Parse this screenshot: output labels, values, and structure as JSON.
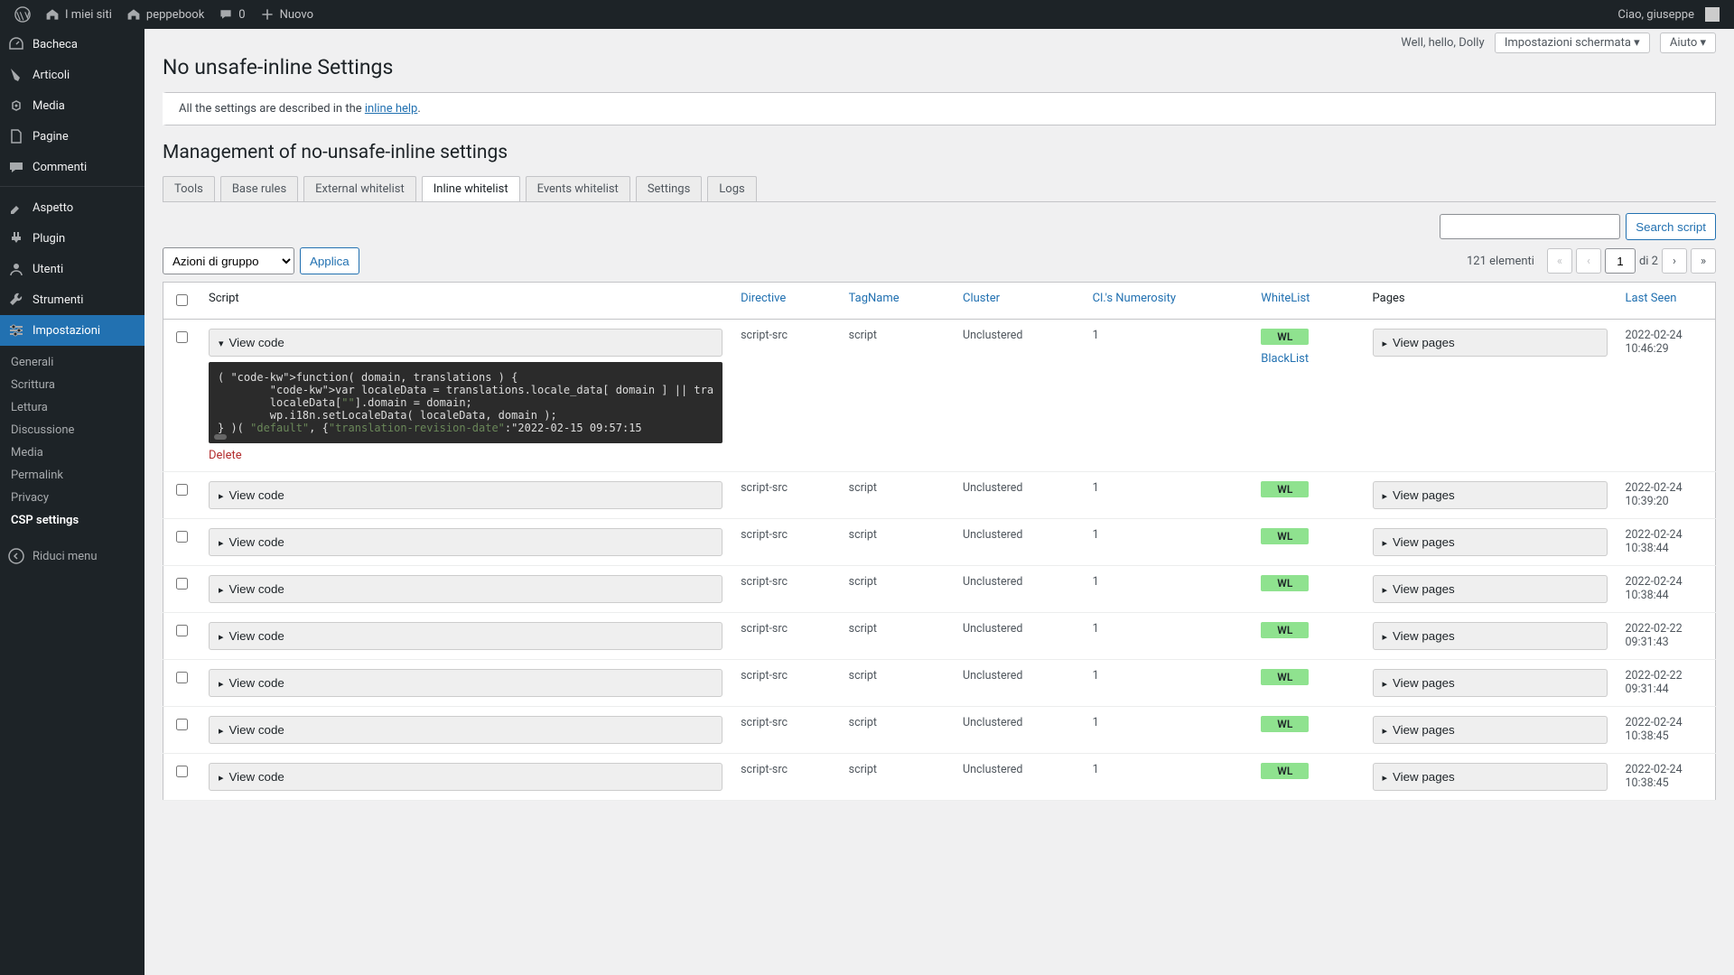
{
  "adminbar": {
    "mysites": "I miei siti",
    "sitename": "peppebook",
    "comments": "0",
    "new": "Nuovo",
    "howdy": "Ciao, giuseppe"
  },
  "sidebar": {
    "items": [
      {
        "icon": "dashboard",
        "label": "Bacheca"
      },
      {
        "icon": "post",
        "label": "Articoli"
      },
      {
        "icon": "media",
        "label": "Media"
      },
      {
        "icon": "page",
        "label": "Pagine"
      },
      {
        "icon": "comments",
        "label": "Commenti"
      },
      {
        "icon": "appearance",
        "label": "Aspetto"
      },
      {
        "icon": "plugin",
        "label": "Plugin"
      },
      {
        "icon": "users",
        "label": "Utenti"
      },
      {
        "icon": "tools",
        "label": "Strumenti"
      },
      {
        "icon": "settings",
        "label": "Impostazioni"
      }
    ],
    "submenu": [
      "Generali",
      "Scrittura",
      "Lettura",
      "Discussione",
      "Media",
      "Permalink",
      "Privacy",
      "CSP settings"
    ],
    "collapse": "Riduci menu"
  },
  "header": {
    "dolly": "Well, hello, Dolly",
    "screenoptions": "Impostazioni schermata",
    "help": "Aiuto",
    "title": "No unsafe-inline Settings",
    "notice_pre": "All the settings are described in the ",
    "notice_link": "inline help",
    "section": "Management of no-unsafe-inline settings"
  },
  "tabs": [
    "Tools",
    "Base rules",
    "External whitelist",
    "Inline whitelist",
    "Events whitelist",
    "Settings",
    "Logs"
  ],
  "active_tab": 3,
  "bulk": {
    "select": "Azioni di gruppo",
    "apply": "Applica"
  },
  "search": {
    "button": "Search script"
  },
  "pager": {
    "count": "121 elementi",
    "page": "1",
    "of": "di 2"
  },
  "columns": {
    "script": "Script",
    "directive": "Directive",
    "tagname": "TagName",
    "cluster": "Cluster",
    "numerosity": "Cl.'s Numerosity",
    "whitelist": "WhiteList",
    "pages": "Pages",
    "lastseen": "Last Seen"
  },
  "buttons": {
    "viewcode": "View code",
    "viewpages": "View pages",
    "delete": "Delete",
    "blacklist": "BlackList"
  },
  "badge": "WL",
  "code_lines": [
    "( function( domain, translations ) {",
    "        var localeData = translations.locale_data[ domain ] || tra",
    "        localeData[\"\"].domain = domain;",
    "        wp.i18n.setLocaleData( localeData, domain );",
    "} )( \"default\", {\"translation-revision-date\":\"2022-02-15 09:57:15"
  ],
  "rows": [
    {
      "directive": "script-src",
      "tagname": "script",
      "cluster": "Unclustered",
      "num": "1",
      "lastseen": "2022-02-24 10:46:29",
      "expanded": true
    },
    {
      "directive": "script-src",
      "tagname": "script",
      "cluster": "Unclustered",
      "num": "1",
      "lastseen": "2022-02-24 10:39:20"
    },
    {
      "directive": "script-src",
      "tagname": "script",
      "cluster": "Unclustered",
      "num": "1",
      "lastseen": "2022-02-24 10:38:44"
    },
    {
      "directive": "script-src",
      "tagname": "script",
      "cluster": "Unclustered",
      "num": "1",
      "lastseen": "2022-02-24 10:38:44"
    },
    {
      "directive": "script-src",
      "tagname": "script",
      "cluster": "Unclustered",
      "num": "1",
      "lastseen": "2022-02-22 09:31:43"
    },
    {
      "directive": "script-src",
      "tagname": "script",
      "cluster": "Unclustered",
      "num": "1",
      "lastseen": "2022-02-22 09:31:44"
    },
    {
      "directive": "script-src",
      "tagname": "script",
      "cluster": "Unclustered",
      "num": "1",
      "lastseen": "2022-02-24 10:38:45"
    },
    {
      "directive": "script-src",
      "tagname": "script",
      "cluster": "Unclustered",
      "num": "1",
      "lastseen": "2022-02-24 10:38:45"
    }
  ]
}
